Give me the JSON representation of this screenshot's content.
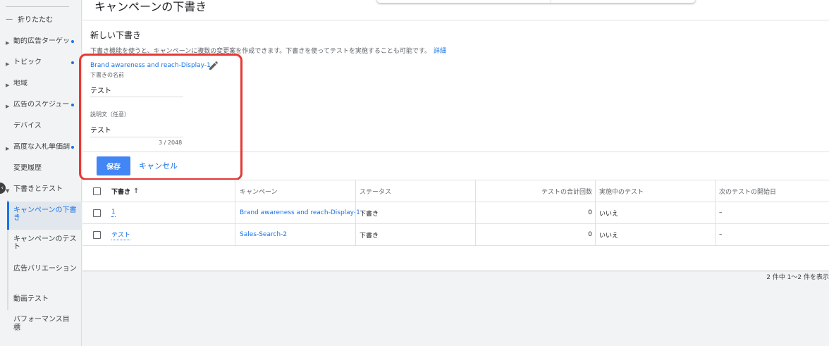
{
  "sidebar": {
    "collapse_label": "折りたたむ",
    "items": [
      {
        "label": "動的広告ターゲッ",
        "dot": true
      },
      {
        "label": "トピック",
        "dot": true
      },
      {
        "label": "地域",
        "dot": false
      },
      {
        "label": "広告のスケジュー",
        "dot": true
      },
      {
        "label": "デバイス",
        "dot": false
      },
      {
        "label": "高度な入札単価調",
        "dot": true
      },
      {
        "label": "変更履歴",
        "dot": false
      },
      {
        "label": "下書きとテスト",
        "dot": false
      }
    ],
    "subitems": [
      {
        "label": "キャンペーンの下書き"
      },
      {
        "label": "キャンペーンのテスト"
      },
      {
        "label": "広告バリエーション"
      },
      {
        "label": "動画テスト"
      },
      {
        "label": "パフォーマンス目標"
      }
    ]
  },
  "header": {
    "title": "キャンペーンの下書き"
  },
  "form": {
    "section_title": "新しい下書き",
    "description": "下書き機能を使うと、キャンペーンに複数の変更案を作成できます。下書きを使ってテストを実施することも可能です。",
    "details_link": "詳細",
    "draft_name_link": "Brand awareness and reach-Display-1",
    "name_label": "下書きの名前",
    "name_value": "テスト",
    "desc_label": "説明文（任意）",
    "desc_value": "テスト",
    "counter": "3 / 2048",
    "save_label": "保存",
    "cancel_label": "キャンセル"
  },
  "table": {
    "headers": [
      "下書き",
      "キャンペーン",
      "ステータス",
      "テストの合計回数",
      "実施中のテスト",
      "次のテストの開始日"
    ],
    "rows": [
      {
        "draft": "1",
        "campaign": "Brand awareness and reach-Display-1",
        "status": "下書き",
        "total": "0",
        "running": "いいえ",
        "next": "–"
      },
      {
        "draft": "テスト",
        "campaign": "Sales-Search-2",
        "status": "下書き",
        "total": "0",
        "running": "いいえ",
        "next": "–"
      }
    ],
    "pager": "2 件中 1〜2 件を表示"
  },
  "colors": {
    "accent": "#1a73e8",
    "save_button": "#4285f4",
    "highlight": "#e53935"
  }
}
